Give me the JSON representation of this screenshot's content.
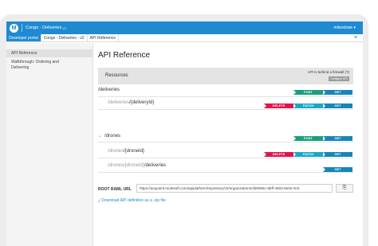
{
  "topbar": {
    "logo": "M",
    "app_title": "Congo - Deliveries",
    "app_badge": "v2",
    "user": "mikestowe ▾"
  },
  "breadcrumbs": [
    {
      "label": "Developer portal"
    },
    {
      "label": "Congo - Deliveries - v2"
    },
    {
      "label": "API Reference"
    }
  ],
  "menu_icon": "≡",
  "sidebar": {
    "items": [
      {
        "label": "API Reference"
      },
      {
        "label": "Walkthrough: Ordering and"
      },
      {
        "label": "Delivering"
      }
    ]
  },
  "main": {
    "title": "API Reference",
    "resources_header": {
      "title": "Resources",
      "firewall_label": "API is behind a firewall (?)",
      "firewall_button": "Configure API"
    },
    "resources": [
      {
        "prefix": "",
        "path": "/deliveries",
        "expand": "",
        "methods": {
          "post": "POST",
          "get": "GET"
        }
      },
      {
        "prefix": "/deliveries",
        "path": "/{deliveryId}",
        "expand": "",
        "methods": {
          "delete": "DELETE",
          "patch": "PATCH",
          "get": "GET"
        }
      },
      {
        "prefix": "",
        "path": "/drones",
        "expand": "⌄",
        "methods": {
          "post": "POST",
          "get": "GET"
        }
      },
      {
        "prefix": "/drones",
        "path": "/{droneId}",
        "expand": "",
        "methods": {
          "delete": "DELETE",
          "patch": "PATCH",
          "get": "GET"
        }
      },
      {
        "prefix": "/drones/{droneId}",
        "path": "/deliveries",
        "expand": "",
        "methods": {
          "get": "GET"
        }
      }
    ],
    "raml": {
      "label": "ROOT RAML URL",
      "url": "https://anypoint.mulesoft.com/apiplatform/repository/v2/organizations/4b9095c-8bff-4903-8e0e-0c5",
      "copy_icon": "⎘"
    },
    "download": {
      "icon": "⤓",
      "label": "Download API definition as a .zip file"
    }
  },
  "colors": {
    "brand": "#1f8ad2",
    "delete": "#e2134d",
    "patch": "#17a9c3",
    "get": "#1685b8",
    "post": "#1b9e7e"
  }
}
